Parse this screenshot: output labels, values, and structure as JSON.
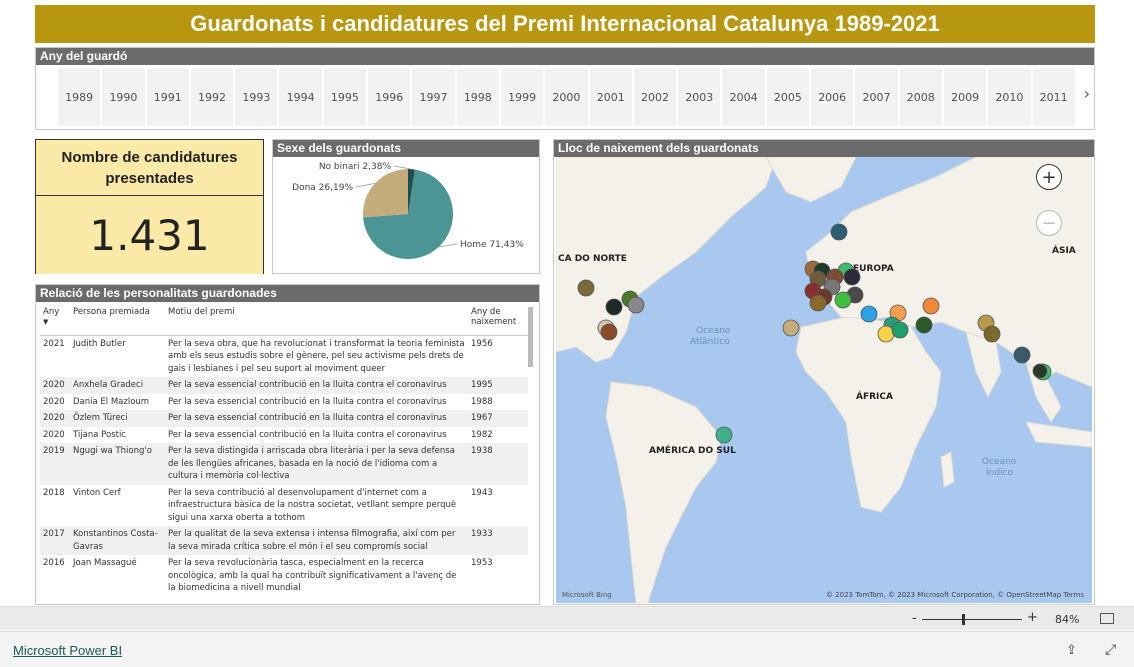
{
  "title": "Guardonats i candidatures del Premi Internacional Catalunya 1989-2021",
  "year_slicer": {
    "header": "Any del guardó",
    "years": [
      "1989",
      "1990",
      "1991",
      "1992",
      "1993",
      "1994",
      "1995",
      "1996",
      "1997",
      "1998",
      "1999",
      "2000",
      "2001",
      "2002",
      "2003",
      "2004",
      "2005",
      "2006",
      "2007",
      "2008",
      "2009",
      "2010",
      "2011"
    ],
    "next_icon": "chevron-right-icon"
  },
  "kpi": {
    "title": "Nombre de candidatures presentades",
    "value": "1.431"
  },
  "pie": {
    "header": "Sexe dels guardonats",
    "slices": [
      {
        "label": "Home 71,43%",
        "value": 71.43,
        "color": "#4b9595"
      },
      {
        "label": "Dona 26,19%",
        "value": 26.19,
        "color": "#c4ad7c"
      },
      {
        "label": "No binari 2,38%",
        "value": 2.38,
        "color": "#1e4d52"
      }
    ]
  },
  "map": {
    "header": "Lloc de naixement dels guardonats",
    "labels": {
      "north_america": "CA DO NORTE",
      "europe": "EUROPA",
      "asia": "ÁSIA",
      "atlantic": "Oceano",
      "atlantic2": "Atlântico",
      "africa": "ÁFRICA",
      "south_america": "AMÉRICA DO SUL",
      "indian": "Oceano",
      "indian2": "Índico"
    },
    "zoom_in": "+",
    "zoom_out": "−",
    "credit": "© 2023 TomTom, © 2023 Microsoft Corporation, © OpenStreetMap  Terms",
    "bing": "Microsoft Bing"
  },
  "table": {
    "header": "Relació de les personalitats guardonades",
    "columns": [
      "Any",
      "Persona premiada",
      "Motiu del premi",
      "Any de naixement"
    ],
    "sort_icon": "▼",
    "rows": [
      {
        "any": "2021",
        "persona": "Judith Butler",
        "motiu": "Per la seva obra, que ha revolucionat i transformat la teoria feminista amb els seus estudis sobre el gènere, pel seu activisme pels drets de gais i lesbianes i pel seu suport al moviment queer",
        "naix": "1956"
      },
      {
        "any": "2020",
        "persona": "Anxhela Gradeci",
        "motiu": "Per la seva essencial contribució en la lluita contra el coronavirus",
        "naix": "1995"
      },
      {
        "any": "2020",
        "persona": "Dania El Mazloum",
        "motiu": "Per la seva essencial contribució en la lluita contra el coronavirus",
        "naix": "1988"
      },
      {
        "any": "2020",
        "persona": "Özlem Türeci",
        "motiu": "Per la seva essencial contribució en la lluita contra el coronavirus",
        "naix": "1967"
      },
      {
        "any": "2020",
        "persona": "Tijana Postic",
        "motiu": "Per la seva essencial contribució en la lluita contra el coronavirus",
        "naix": "1982"
      },
      {
        "any": "2019",
        "persona": "Ngugi wa Thiong'o",
        "motiu": "Per la seva distingida i arriscada obra literària i per la seva defensa de les llengües africanes, basada en la noció de l'idioma com a cultura i memòria col·lectiva",
        "naix": "1938"
      },
      {
        "any": "2018",
        "persona": "Vinton Cerf",
        "motiu": "Per la seva contribució al desenvolupament d'internet com a infraestructura bàsica de la nostra societat, vetllant sempre perquè sigui una xarxa oberta a tothom",
        "naix": "1943"
      },
      {
        "any": "2017",
        "persona": "Konstantinos Costa-Gavras",
        "motiu": "Per la qualitat de la seva extensa i intensa filmografia, així com per la seva mirada crítica sobre el món i el seu compromís social",
        "naix": "1933"
      },
      {
        "any": "2016",
        "persona": "Joan Massagué",
        "motiu": "Per la seva revolucionària tasca, especialment en la recerca oncològica, amb la qual ha contribuït significativament a l'avenç de la biomedicina a nivell mundial",
        "naix": "1953"
      }
    ]
  },
  "zoom_bar": {
    "minus": "-",
    "plus": "+",
    "percent": "84%"
  },
  "footer": {
    "link": "Microsoft Power BI",
    "share_icon": "share-icon",
    "expand_icon": "expand-icon"
  }
}
